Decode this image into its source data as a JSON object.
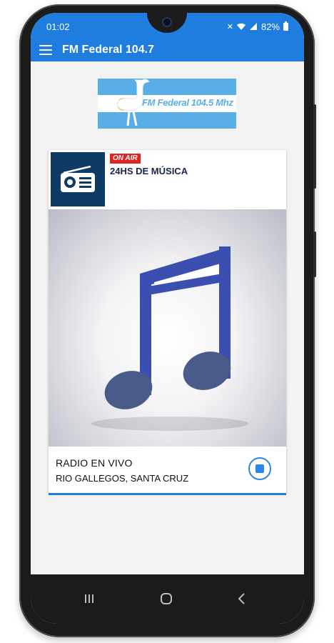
{
  "status_bar": {
    "time": "01:02",
    "battery_text": "82%"
  },
  "app_bar": {
    "title": "FM Federal 104.7",
    "color": "#1f7de0"
  },
  "logo": {
    "text": "FM Federal 104.5 Mhz"
  },
  "now_playing": {
    "badge": "ON AIR",
    "program": "24HS DE MÚSICA",
    "station_label": "RADIO EN VIVO",
    "location": "RIO GALLEGOS, SANTA CRUZ"
  },
  "icons": {
    "menu": "menu-icon",
    "radio": "radio-icon",
    "music_note": "music-note-icon",
    "stop": "stop-icon",
    "recent_apps": "recent-apps-icon",
    "home": "home-icon",
    "back": "back-icon"
  },
  "colors": {
    "accent": "#1f7de0",
    "on_air": "#e02424",
    "note": "#3b4fb0"
  }
}
